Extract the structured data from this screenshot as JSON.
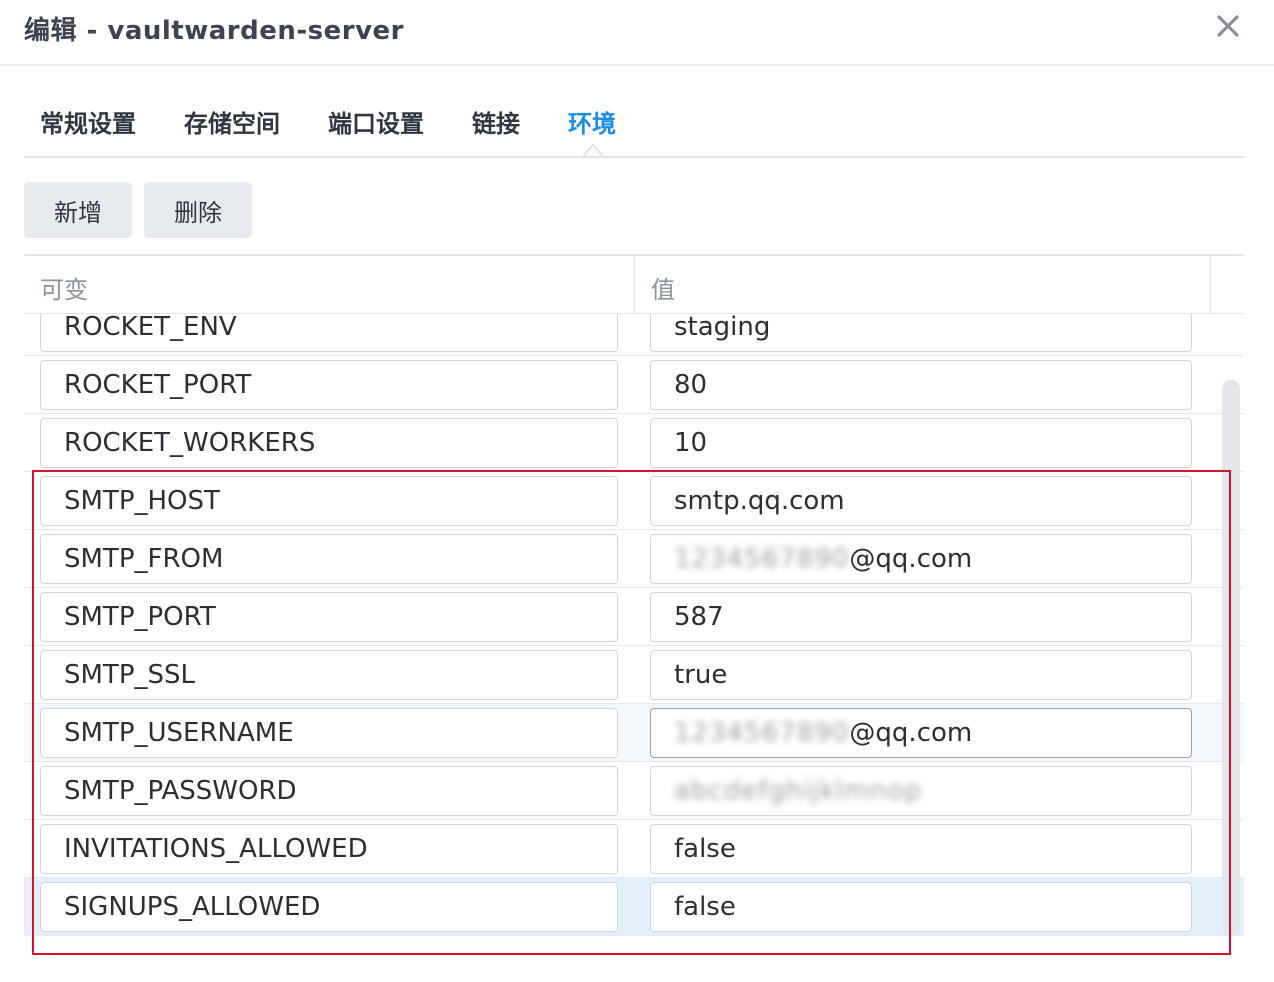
{
  "window": {
    "title": "编辑 - vaultwarden-server",
    "close_icon": "close-icon"
  },
  "tabs": [
    {
      "label": "常规设置",
      "active": false
    },
    {
      "label": "存储空间",
      "active": false
    },
    {
      "label": "端口设置",
      "active": false
    },
    {
      "label": "链接",
      "active": false
    },
    {
      "label": "环境",
      "active": true
    }
  ],
  "toolbar": {
    "add_label": "新增",
    "delete_label": "删除"
  },
  "grid": {
    "columns": {
      "variable": "可变",
      "value": "值"
    },
    "rows": [
      {
        "key": "ROCKET_ENV",
        "value": "staging"
      },
      {
        "key": "ROCKET_PORT",
        "value": "80"
      },
      {
        "key": "ROCKET_WORKERS",
        "value": "10"
      },
      {
        "key": "SMTP_HOST",
        "value": "smtp.qq.com"
      },
      {
        "key": "SMTP_FROM",
        "value_hidden": "1234567890",
        "value_suffix": "@qq.com"
      },
      {
        "key": "SMTP_PORT",
        "value": "587"
      },
      {
        "key": "SMTP_SSL",
        "value": "true"
      },
      {
        "key": "SMTP_USERNAME",
        "value_hidden": "1234567890",
        "value_suffix": "@qq.com"
      },
      {
        "key": "SMTP_PASSWORD",
        "value_hidden": "abcdefghijklmnop"
      },
      {
        "key": "INVITATIONS_ALLOWED",
        "value": "false"
      },
      {
        "key": "SIGNUPS_ALLOWED",
        "value": "false"
      }
    ]
  },
  "colors": {
    "accent": "#1a8ee6",
    "annotation": "#d7132a",
    "selected_row": "#e3effb"
  }
}
